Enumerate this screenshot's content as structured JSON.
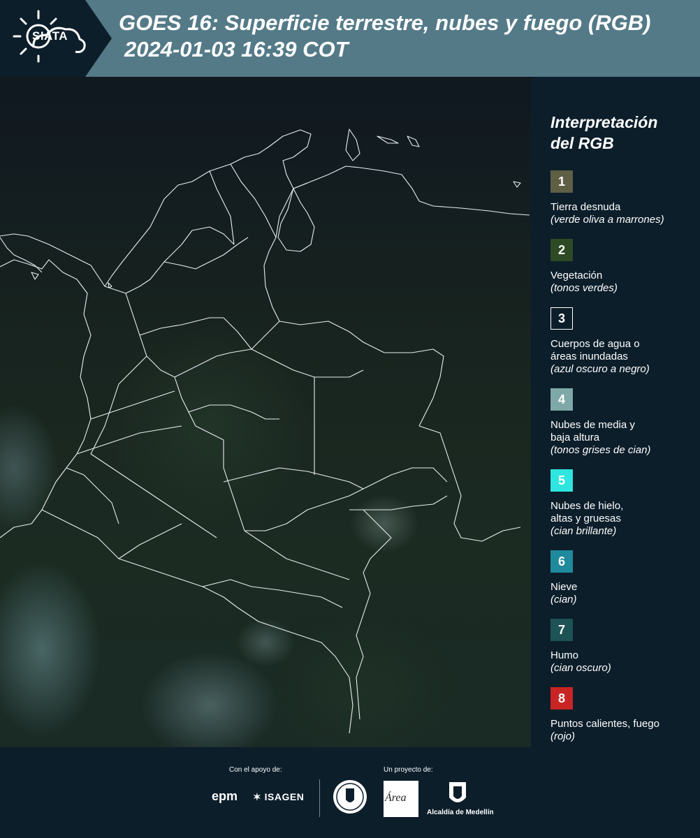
{
  "header": {
    "logo_text": "SIATA",
    "title_line1": "GOES 16: Superficie terrestre, nubes y fuego (RGB)",
    "title_line2": "2024-01-03 16:39 COT"
  },
  "legend": {
    "title_line1": "Interpretación",
    "title_line2": "del RGB",
    "items": [
      {
        "num": "1",
        "color": "#5f5f45",
        "label": "Tierra desnuda",
        "sub": "(verde oliva a marrones)"
      },
      {
        "num": "2",
        "color": "#2e4a25",
        "label": "Vegetación",
        "sub": "(tonos verdes)"
      },
      {
        "num": "3",
        "color": "#0c1e2a",
        "label": "Cuerpos de agua o áreas inundadas",
        "sub": "(azul oscuro a negro)"
      },
      {
        "num": "4",
        "color": "#7fa8a8",
        "label": "Nubes de media y baja altura",
        "sub": "(tonos grises de cian)"
      },
      {
        "num": "5",
        "color": "#2ee6df",
        "label": "Nubes de hielo, altas y gruesas",
        "sub": "(cian brillante)"
      },
      {
        "num": "6",
        "color": "#1f8a9c",
        "label": "Nieve",
        "sub": "(cian)"
      },
      {
        "num": "7",
        "color": "#1e5355",
        "label": "Humo",
        "sub": "(cian oscuro)"
      },
      {
        "num": "8",
        "color": "#c92424",
        "label": "Puntos calientes, fuego",
        "sub": "(rojo)"
      }
    ]
  },
  "footer": {
    "support_label": "Con el apoyo de:",
    "project_label": "Un proyecto de:",
    "epm": "epm",
    "isagen": "ISAGEN",
    "area_logo": "Área",
    "alcaldia": "Alcaldía de Medellín"
  }
}
